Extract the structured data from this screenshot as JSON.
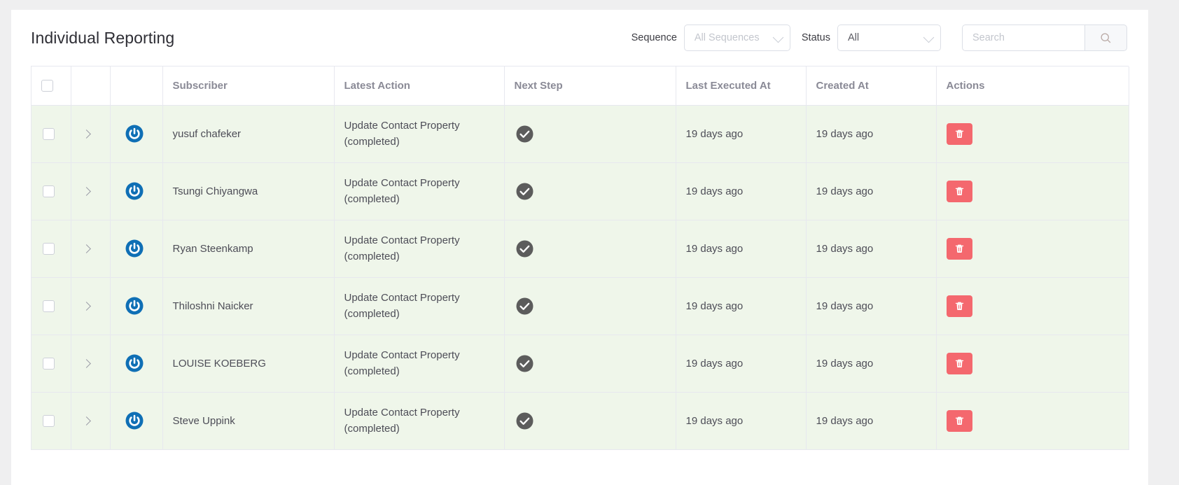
{
  "header": {
    "title": "Individual Reporting",
    "sequence_label": "Sequence",
    "sequence_value": "All Sequences",
    "status_label": "Status",
    "status_value": "All",
    "search_placeholder": "Search",
    "search_value": "",
    "search_icon": "search-icon"
  },
  "table": {
    "columns": [
      {
        "key": "check",
        "label": ""
      },
      {
        "key": "expand",
        "label": ""
      },
      {
        "key": "icon",
        "label": ""
      },
      {
        "key": "sub",
        "label": "Subscriber"
      },
      {
        "key": "action",
        "label": "Latest Action"
      },
      {
        "key": "next",
        "label": "Next Step"
      },
      {
        "key": "last",
        "label": "Last Executed At"
      },
      {
        "key": "created",
        "label": "Created At"
      },
      {
        "key": "actions",
        "label": "Actions"
      }
    ],
    "rows": [
      {
        "subscriber": "yusuf chafeker",
        "latest_action": "Update Contact Property (completed)",
        "next_step_icon": "check-circle-icon",
        "last_executed_at": "19 days ago",
        "created_at": "19 days ago",
        "row_icon": "power-icon",
        "delete_icon": "trash-icon"
      },
      {
        "subscriber": "Tsungi Chiyangwa",
        "latest_action": "Update Contact Property (completed)",
        "next_step_icon": "check-circle-icon",
        "last_executed_at": "19 days ago",
        "created_at": "19 days ago",
        "row_icon": "power-icon",
        "delete_icon": "trash-icon"
      },
      {
        "subscriber": "Ryan Steenkamp",
        "latest_action": "Update Contact Property (completed)",
        "next_step_icon": "check-circle-icon",
        "last_executed_at": "19 days ago",
        "created_at": "19 days ago",
        "row_icon": "power-icon",
        "delete_icon": "trash-icon"
      },
      {
        "subscriber": "Thiloshni Naicker",
        "latest_action": "Update Contact Property (completed)",
        "next_step_icon": "check-circle-icon",
        "last_executed_at": "19 days ago",
        "created_at": "19 days ago",
        "row_icon": "power-icon",
        "delete_icon": "trash-icon"
      },
      {
        "subscriber": "LOUISE KOEBERG",
        "latest_action": "Update Contact Property (completed)",
        "next_step_icon": "check-circle-icon",
        "last_executed_at": "19 days ago",
        "created_at": "19 days ago",
        "row_icon": "power-icon",
        "delete_icon": "trash-icon"
      },
      {
        "subscriber": "Steve Uppink",
        "latest_action": "Update Contact Property (completed)",
        "next_step_icon": "check-circle-icon",
        "last_executed_at": "19 days ago",
        "created_at": "19 days ago",
        "row_icon": "power-icon",
        "delete_icon": "trash-icon"
      }
    ]
  },
  "colors": {
    "page_bg": "#efeff0",
    "card_bg": "#ffffff",
    "row_bg": "#eff6ea",
    "border": "#e7e8ef",
    "header_text": "#8a8a96",
    "body_text": "#4d4d57",
    "power_blue": "#0f6fb5",
    "check_gray": "#5c5c5c",
    "delete_red": "#f4686e"
  }
}
